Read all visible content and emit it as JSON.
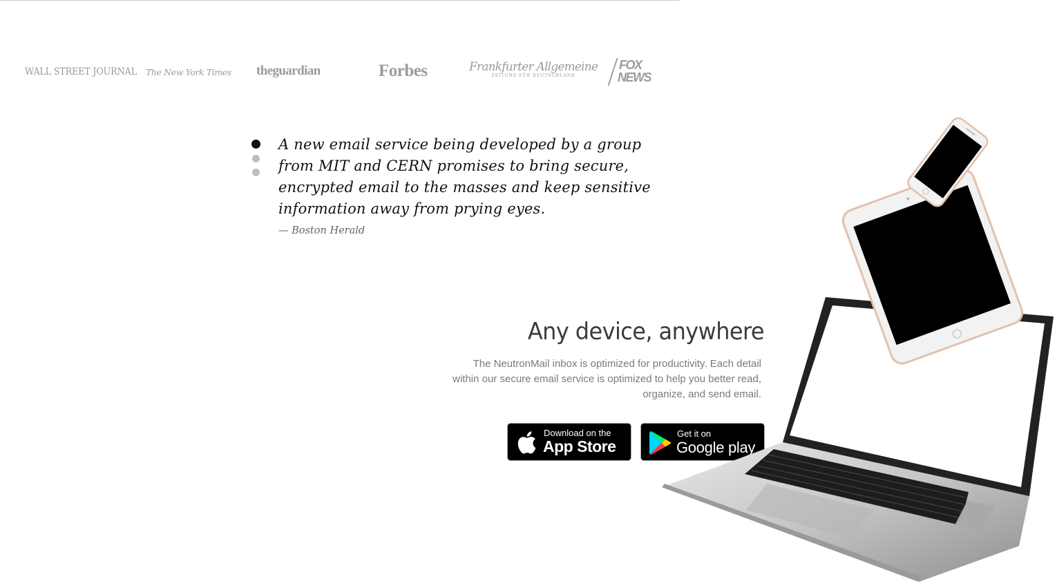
{
  "press": {
    "logos": [
      {
        "name": "WALL STREET JOURNAL"
      },
      {
        "name": "The New York Times"
      },
      {
        "name": "theguardian"
      },
      {
        "name": "Forbes"
      },
      {
        "name": "Frankfurter Allgemeine",
        "sub": "ZEITUNG FÜR DEUTSCHLAND"
      },
      {
        "name": "FOX",
        "line2": "NEWS"
      }
    ]
  },
  "testimonial": {
    "quote": "A new email service being developed by a group from MIT and CERN promises to bring secure, encrypted email to the masses and keep sensitive information away from prying eyes.",
    "source": "— Boston Herald",
    "active_index": 0,
    "total": 3
  },
  "devices": {
    "title": "Any device, anywhere",
    "text": "The NeutronMail inbox is optimized for productivity. Each detail within our secure email service is optimized to help you better read, organize, and send email.",
    "app_store": {
      "small": "Download on the",
      "big": "App Store"
    },
    "google_play": {
      "small": "Get it on",
      "big": "Google play"
    }
  },
  "colors": {
    "logo_gray": "#9b9b9b",
    "dot_active": "#111111",
    "dot_inactive": "#bdbdbd",
    "button_bg": "#000000"
  },
  "icons": [
    "apple-icon",
    "google-play-icon"
  ]
}
